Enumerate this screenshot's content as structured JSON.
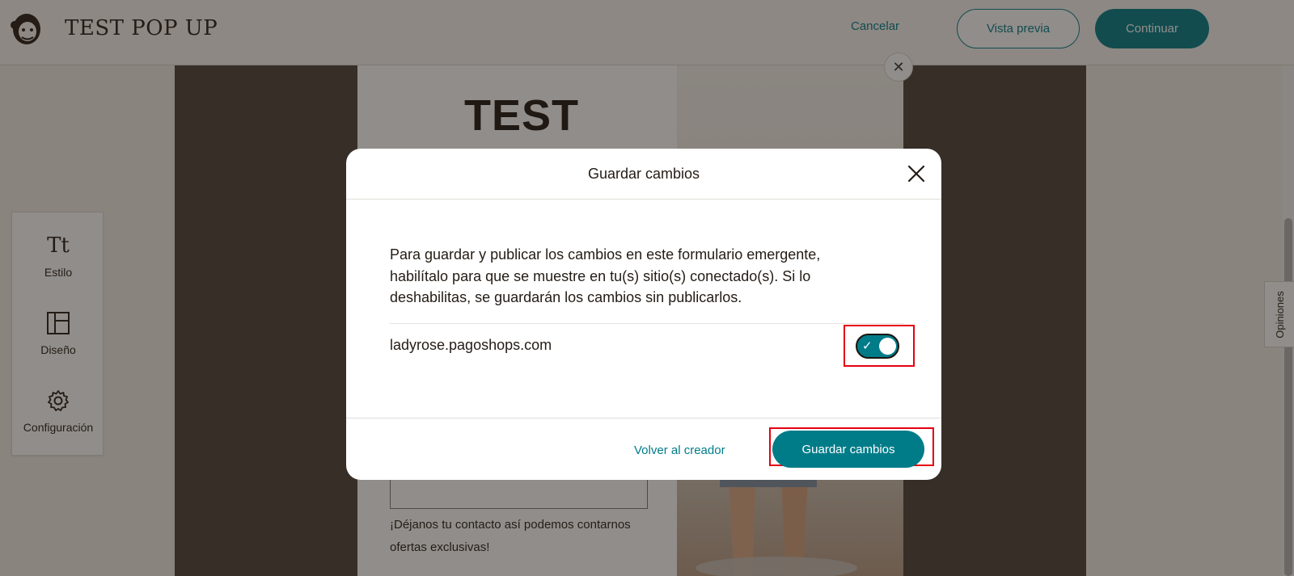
{
  "header": {
    "title": "TEST POP UP",
    "cancel_label": "Cancelar",
    "preview_label": "Vista previa",
    "continue_label": "Continuar"
  },
  "sidebar": {
    "items": [
      {
        "label": "Estilo",
        "icon": "text-style-icon",
        "glyph": "Tt"
      },
      {
        "label": "Diseño",
        "icon": "layout-icon"
      },
      {
        "label": "Configuración",
        "icon": "gear-icon"
      }
    ]
  },
  "popup_preview": {
    "headline": "TEST",
    "hint_text": "¡Déjanos tu contacto así podemos contarnos ofertas exclusivas!"
  },
  "feedback_tab": {
    "label": "Opiniones"
  },
  "modal": {
    "title": "Guardar cambios",
    "body": "Para guardar y publicar los cambios en este formulario emergente, habilítalo para que se muestre en tu(s) sitio(s) conectado(s). Si lo deshabilitas, se guardarán los cambios sin publicarlos.",
    "site": "ladyrose.pagoshops.com",
    "toggle_enabled": true,
    "back_label": "Volver al creador",
    "save_label": "Guardar cambios"
  },
  "colors": {
    "accent": "#007c89",
    "highlight": "#e60012",
    "overlay": "rgba(36, 28, 21, 0.5)"
  }
}
